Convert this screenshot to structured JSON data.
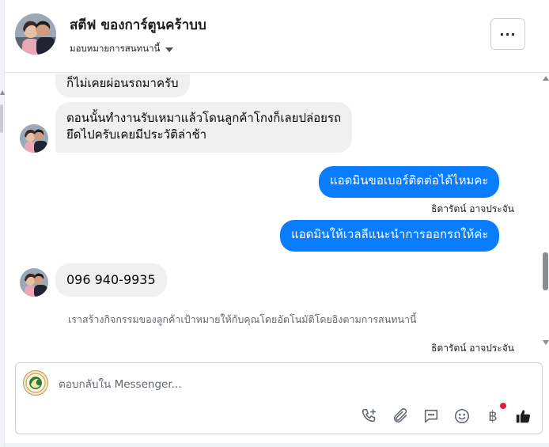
{
  "header": {
    "contact_name": "สตีฟ ของการ์ตูนคร้าบบ",
    "assign_label": "มอบหมายการสนทนานี้",
    "more_icon": "ellipsis-icon"
  },
  "messages": [
    {
      "direction": "in",
      "text": "ก็ไม่เคยผ่อนรถมาครับ"
    },
    {
      "direction": "in",
      "lines": [
        "ตอนนั้นทำงานรับเหมาแล้วโดนลูกค้าโกงก็เลยปล่อยรถ",
        "ยึดไปครับเคยมีประวัติล่าช้า"
      ]
    },
    {
      "direction": "out",
      "text": "แอดมินขอเบอร์ติดต่อได้ไหมคะ",
      "sender": "ธิดารัตน์ อาจประจัน"
    },
    {
      "direction": "out",
      "text": "แอดมินให้เวลลีแนะนำการออกรถให้ค่ะ"
    },
    {
      "direction": "in",
      "text": "096 940-9935"
    }
  ],
  "notice": "เราสร้างกิจกรรมของลูกค้าเป้าหมายให้กับคุณโดยอัตโนมัติโดยอิงตามการสนทนานี้",
  "last_sender": "ธิดารัตน์ อาจประจัน",
  "composer": {
    "placeholder": "ตอบกลับใน Messenger...",
    "tools": [
      "phone-add-icon",
      "paperclip-icon",
      "saved-reply-icon",
      "emoji-icon",
      "baht-payment-icon",
      "thumbs-up-icon"
    ],
    "baht_symbol": "฿"
  },
  "colors": {
    "outgoing_bubble": "#0a7cff",
    "incoming_bubble": "#f0f0f0",
    "notification_dot": "#e41e3f"
  }
}
